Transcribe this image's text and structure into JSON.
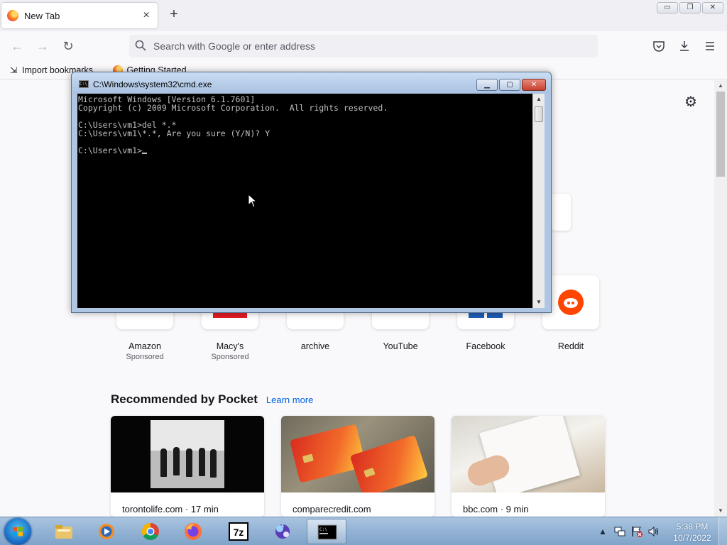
{
  "browser": {
    "tab": {
      "title": "New Tab",
      "close": "×"
    },
    "new_tab": "+",
    "window_controls": {
      "minimize": "▭",
      "restore": "❐",
      "close": "✕"
    },
    "nav": {
      "back": "←",
      "forward": "→",
      "reload": "↻"
    },
    "urlbar": {
      "placeholder": "Search with Google or enter address"
    },
    "toolbar_icons": [
      "pocket-icon",
      "downloads-icon",
      "menu-icon"
    ],
    "bookmarks": [
      {
        "label": "Import bookmarks..."
      },
      {
        "label": "Getting Started"
      }
    ]
  },
  "newtab": {
    "shortcuts": [
      {
        "name": "Amazon",
        "sponsor": "Sponsored"
      },
      {
        "name": "Macy's",
        "sponsor": "Sponsored"
      },
      {
        "name": "archive",
        "sponsor": ""
      },
      {
        "name": "YouTube",
        "sponsor": ""
      },
      {
        "name": "Facebook",
        "sponsor": ""
      },
      {
        "name": "Reddit",
        "sponsor": ""
      }
    ],
    "pocket": {
      "title": "Recommended by Pocket",
      "learn_more": "Learn more",
      "cards": [
        {
          "source": "torontolife.com · 17 min"
        },
        {
          "source": "comparecredit.com"
        },
        {
          "source": "bbc.com · 9 min"
        }
      ]
    }
  },
  "cmd": {
    "title": "C:\\Windows\\system32\\cmd.exe",
    "lines": [
      "Microsoft Windows [Version 6.1.7601]",
      "Copyright (c) 2009 Microsoft Corporation.  All rights reserved.",
      "",
      "C:\\Users\\vm1>del *.*",
      "C:\\Users\\vm1\\*.*, Are you sure (Y/N)? Y",
      "",
      "C:\\Users\\vm1>"
    ]
  },
  "taskbar": {
    "apps": [
      "explorer",
      "media-player",
      "chrome",
      "firefox",
      "7-zip",
      "app",
      "cmd"
    ],
    "active_app": "cmd",
    "clock": {
      "time": "5:38 PM",
      "date": "10/7/2022"
    }
  },
  "colors": {
    "firefox_bg": "#f9f9fb",
    "link": "#0061e0",
    "cmd_bg": "#000000",
    "cmd_text": "#c0c0c0",
    "reddit": "#ff4500",
    "macys": "#e21a23",
    "facebook": "#1f5db5"
  }
}
